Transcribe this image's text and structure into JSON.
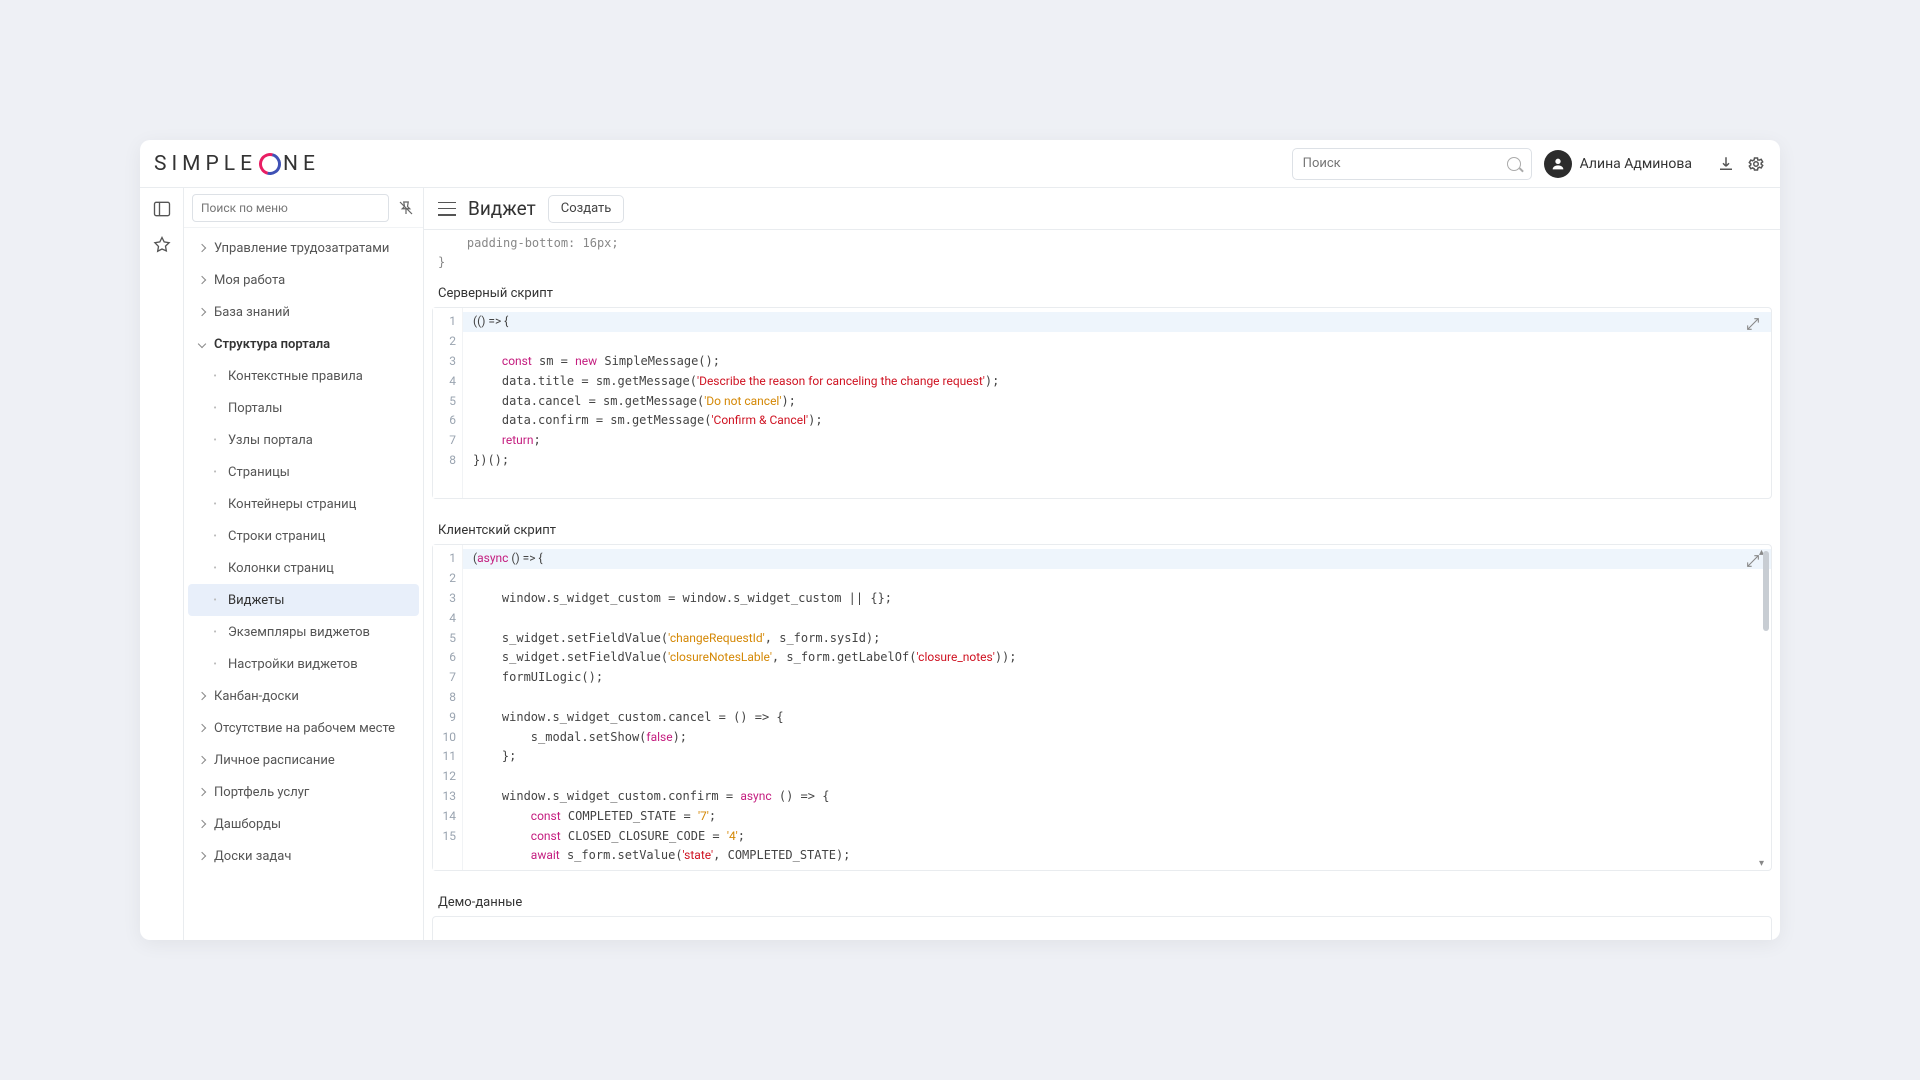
{
  "brand": {
    "pre": "SIMPLE",
    "post": "NE"
  },
  "topbar": {
    "search_placeholder": "Поиск",
    "username": "Алина Админова"
  },
  "sidebar": {
    "menu_search_placeholder": "Поиск по меню",
    "items_top": [
      "Управление трудозатратами",
      "Моя работа",
      "База знаний"
    ],
    "expanded_label": "Структура портала",
    "children": [
      "Контекстные правила",
      "Порталы",
      "Узлы портала",
      "Страницы",
      "Контейнеры страниц",
      "Строки страниц",
      "Колонки страниц",
      "Виджеты",
      "Экземпляры виджетов",
      "Настройки виджетов"
    ],
    "active_index": 7,
    "items_bottom": [
      "Канбан-доски",
      "Отсутствие на рабочем месте",
      "Личное расписание",
      "Портфель услуг",
      "Дашборды",
      "Доски задач"
    ]
  },
  "header": {
    "title": "Виджет",
    "create_label": "Создать"
  },
  "stub_code": "    padding-bottom: 16px;\n}",
  "server": {
    "label": "Серверный скрипт",
    "lines": 8,
    "code_html": "<span class='hl-row'>(() => {</span>\n    <span class='kw'>const</span> sm = <span class='kw'>new</span> SimpleMessage();\n    data.title = sm.getMessage(<span class='str2'>'Describe the reason for canceling the change request'</span>);\n    data.cancel = sm.getMessage(<span class='str'>'Do not cancel'</span>);\n    data.confirm = sm.getMessage(<span class='str2'>'Confirm & Cancel'</span>);\n    <span class='kw'>return</span>;\n})();\n"
  },
  "client": {
    "label": "Клиентский скрипт",
    "lines": 15,
    "code_html": "<span class='hl-row'>(<span class='kw'>async</span> () => {</span>\n    window.s_widget_custom = window.s_widget_custom || {};\n\n    s_widget.setFieldValue(<span class='str'>'changeRequestId'</span>, s_form.sysId);\n    s_widget.setFieldValue(<span class='str'>'closureNotesLable'</span>, s_form.getLabelOf(<span class='str2'>'closure_notes'</span>));\n    formUILogic();\n\n    window.s_widget_custom.cancel = () => {\n        s_modal.setShow(<span class='kw'>false</span>);\n    };\n\n    window.s_widget_custom.confirm = <span class='kw'>async</span> () => {\n        <span class='kw'>const</span> COMPLETED_STATE = <span class='str'>'7'</span>;\n        <span class='kw'>const</span> CLOSED_CLOSURE_CODE = <span class='str'>'4'</span>;\n        <span class='kw'>await</span> s_form.setValue(<span class='str2'>'state'</span>, COMPLETED_STATE);"
  },
  "demo": {
    "label": "Демо-данные"
  }
}
